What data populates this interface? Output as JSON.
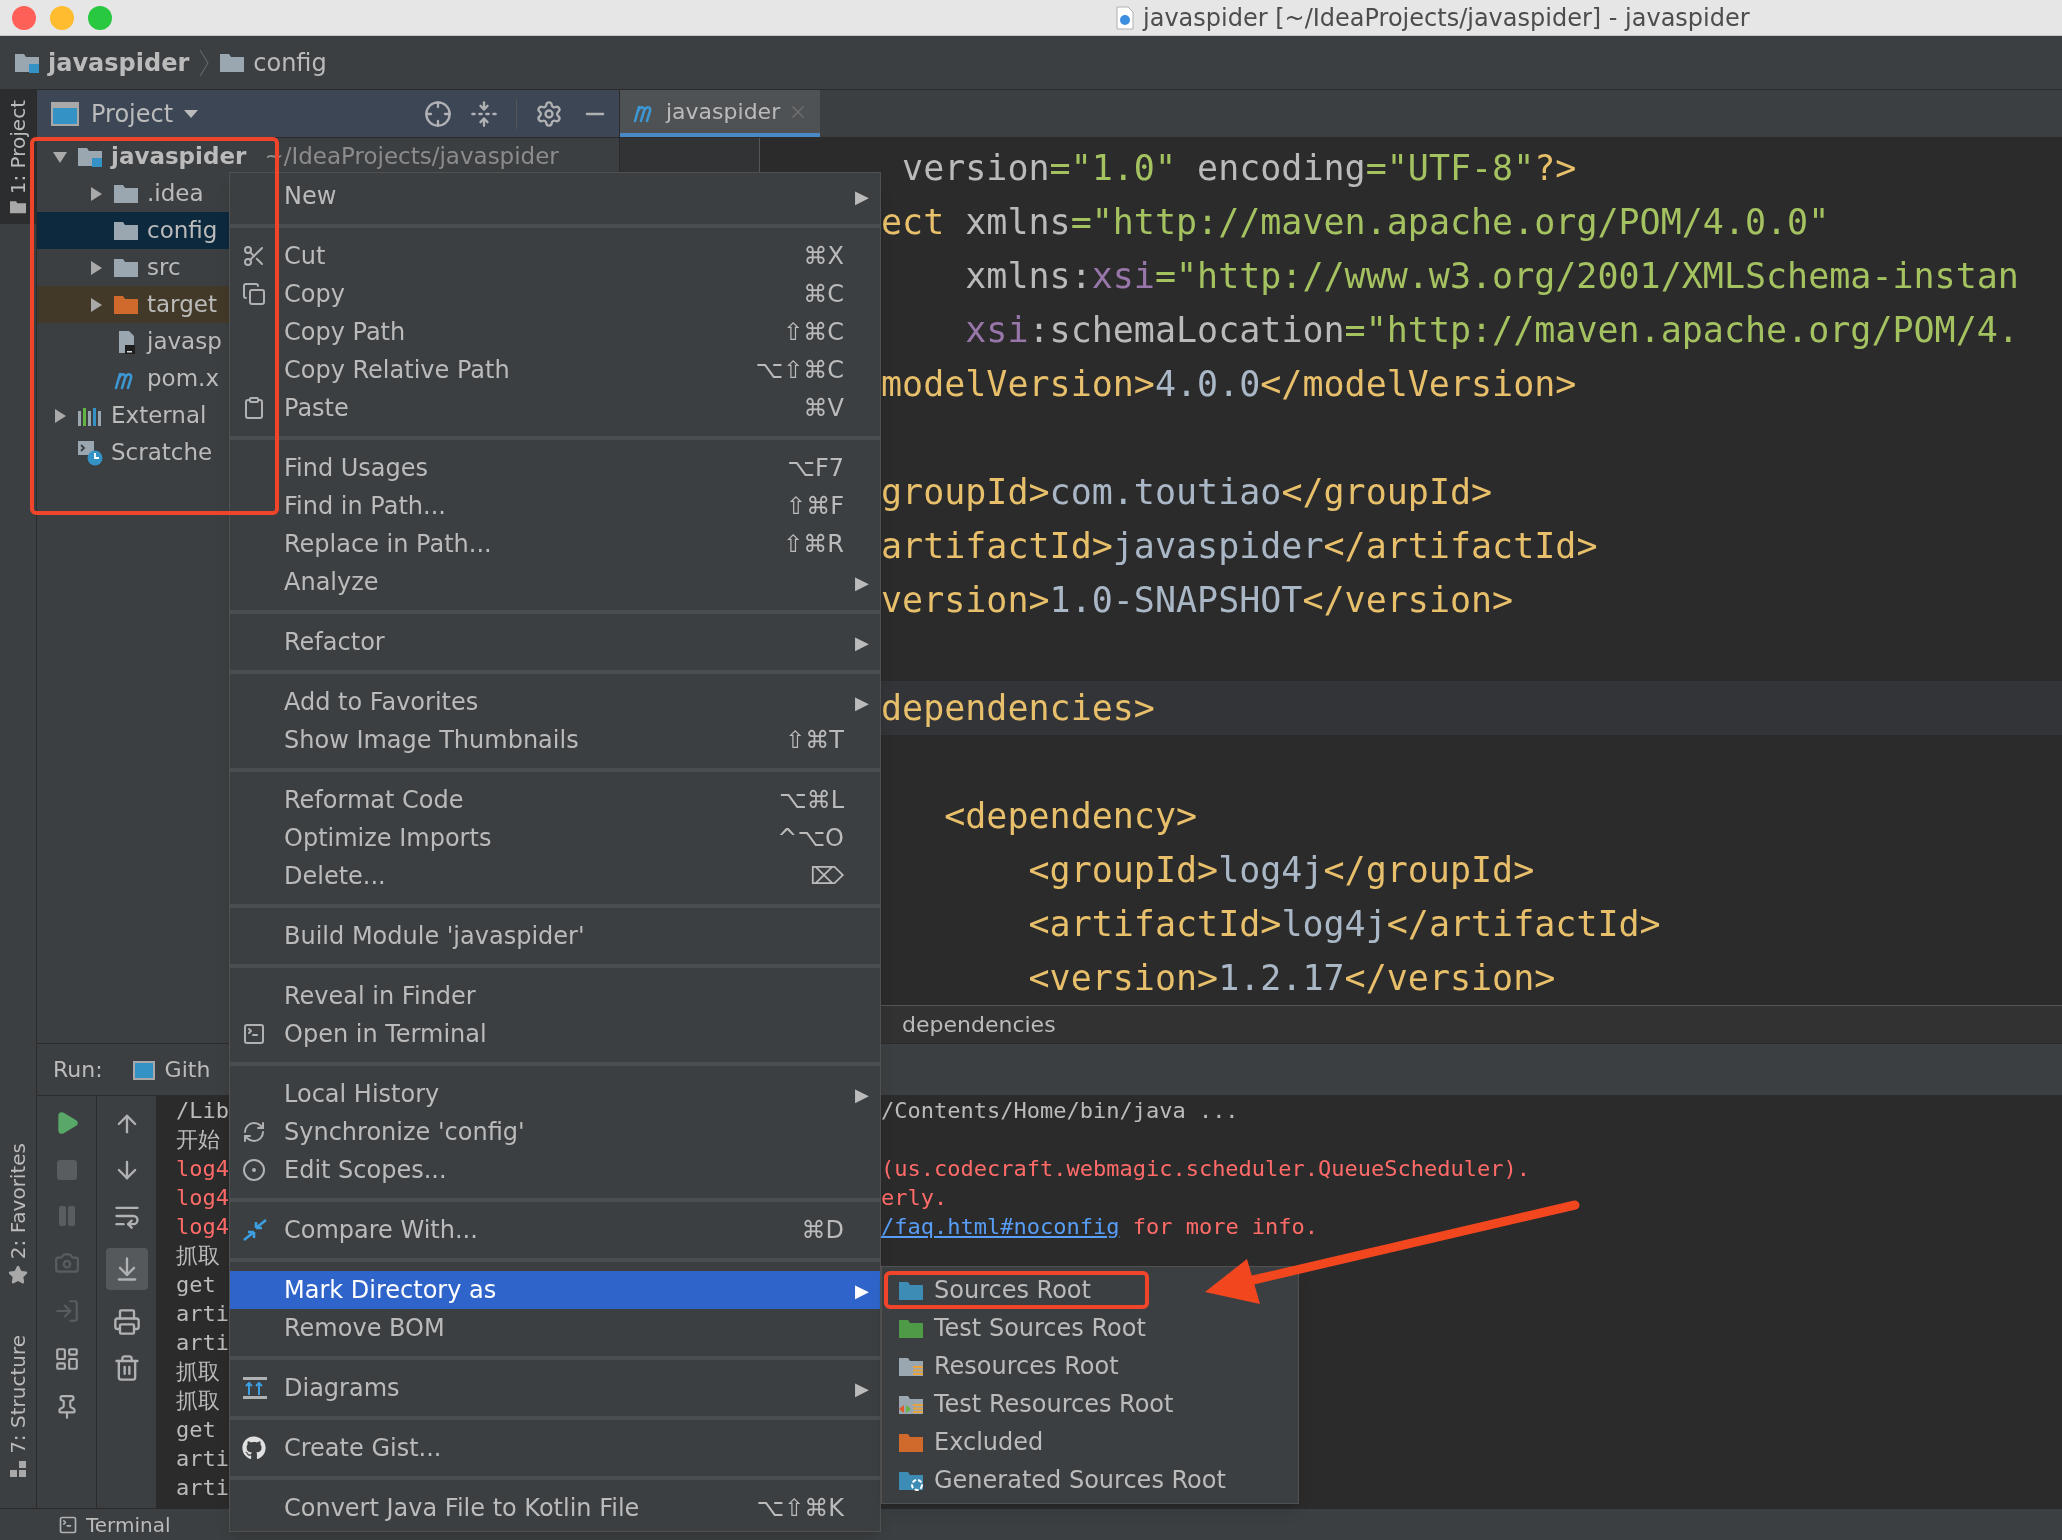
{
  "window": {
    "title": "javaspider [~/IdeaProjects/javaspider] - javaspider"
  },
  "breadcrumb": [
    {
      "label": "javaspider",
      "kind": "module"
    },
    {
      "label": "config",
      "kind": "folder"
    }
  ],
  "tool_window_tabs": [
    {
      "label": "1: Project",
      "selected": true,
      "kind": "project"
    },
    {
      "label": "2: Favorites",
      "selected": false,
      "kind": "favorites"
    },
    {
      "label": "7: Structure",
      "selected": false,
      "kind": "structure"
    }
  ],
  "project_panel": {
    "title": "Project",
    "tree": [
      {
        "label": "javaspider",
        "path": "~/IdeaProjects/javaspider",
        "kind": "module",
        "expanded": true,
        "selected": false,
        "children": [
          {
            "label": ".idea",
            "kind": "folder",
            "expanded": false,
            "selected": false
          },
          {
            "label": "config",
            "kind": "folder",
            "selected": true
          },
          {
            "label": "src",
            "kind": "folder",
            "expanded": false,
            "selected": false
          },
          {
            "label": "target",
            "kind": "excluded-folder",
            "expanded": false,
            "selected": false
          },
          {
            "label": "javasp",
            "kind": "iml-file",
            "selected": false
          },
          {
            "label": "pom.x",
            "kind": "maven-file",
            "selected": false
          }
        ]
      },
      {
        "label": "External",
        "kind": "libraries",
        "expanded": false,
        "selected": false
      },
      {
        "label": "Scratche",
        "kind": "scratches",
        "selected": false
      }
    ]
  },
  "editor": {
    "tabs": [
      {
        "label": "javaspider",
        "selected": true
      }
    ],
    "lines": [
      {
        "current": false,
        "tokens": [
          {
            "text": " version",
            "kind": "attr"
          },
          {
            "text": "=\"1.0\"",
            "kind": "string"
          },
          {
            "text": " encoding",
            "kind": "attr"
          },
          {
            "text": "=\"UTF-8\"",
            "kind": "string"
          },
          {
            "text": "?>",
            "kind": "tag"
          }
        ]
      },
      {
        "current": false,
        "tokens": [
          {
            "text": "ect",
            "kind": "tag"
          },
          {
            "text": " xmlns",
            "kind": "attr"
          },
          {
            "text": "=\"http://maven.apache.org/POM/4.0.0\"",
            "kind": "string"
          }
        ]
      },
      {
        "current": false,
        "tokens": [
          {
            "text": "    xmlns:",
            "kind": "attr"
          },
          {
            "text": "xsi",
            "kind": "ns"
          },
          {
            "text": "=\"http://www.w3.org/2001/XMLSchema-instan",
            "kind": "string"
          }
        ]
      },
      {
        "current": false,
        "tokens": [
          {
            "text": "    xsi",
            "kind": "ns"
          },
          {
            "text": ":schemaLocation",
            "kind": "attr"
          },
          {
            "text": "=\"http://maven.apache.org/POM/4.",
            "kind": "string"
          }
        ]
      },
      {
        "current": false,
        "tokens": [
          {
            "text": "modelVersion>",
            "kind": "tag"
          },
          {
            "text": "4.0.0",
            "kind": "text"
          },
          {
            "text": "</modelVersion>",
            "kind": "tag"
          }
        ]
      },
      {
        "current": false
      },
      {
        "current": false,
        "tokens": [
          {
            "text": "groupId>",
            "kind": "tag"
          },
          {
            "text": "com.toutiao",
            "kind": "text"
          },
          {
            "text": "</groupId>",
            "kind": "tag"
          }
        ]
      },
      {
        "current": false,
        "tokens": [
          {
            "text": "artifactId>",
            "kind": "tag"
          },
          {
            "text": "javaspider",
            "kind": "text"
          },
          {
            "text": "</artifactId>",
            "kind": "tag"
          }
        ]
      },
      {
        "current": false,
        "tokens": [
          {
            "text": "version>",
            "kind": "tag"
          },
          {
            "text": "1.0-SNAPSHOT",
            "kind": "text"
          },
          {
            "text": "</version>",
            "kind": "tag"
          }
        ]
      },
      {
        "current": false
      },
      {
        "current": true,
        "tokens": [
          {
            "text": "dependencies>",
            "kind": "tag"
          }
        ]
      },
      {
        "current": false
      },
      {
        "current": false,
        "tokens": [
          {
            "text": "   <dependency>",
            "kind": "tag"
          }
        ]
      },
      {
        "current": false,
        "tokens": [
          {
            "text": "       <groupId>",
            "kind": "tag"
          },
          {
            "text": "log4j",
            "kind": "text"
          },
          {
            "text": "</groupId>",
            "kind": "tag"
          }
        ]
      },
      {
        "current": false,
        "tokens": [
          {
            "text": "       <artifactId>",
            "kind": "tag"
          },
          {
            "text": "log4j",
            "kind": "text"
          },
          {
            "text": "</artifactId>",
            "kind": "tag"
          }
        ]
      },
      {
        "current": false,
        "tokens": [
          {
            "text": "       <version>",
            "kind": "tag"
          },
          {
            "text": "1.2.17",
            "kind": "text"
          },
          {
            "text": "</version>",
            "kind": "tag"
          }
        ]
      }
    ],
    "breadcrumb": "dependencies"
  },
  "run_panel": {
    "title": "Run:",
    "tabs": [
      {
        "label": "Gith"
      }
    ],
    "scroll_to_end": {
      "selected": true
    },
    "console": [
      {
        "left": "/Lib",
        "kind": "info",
        "segments": [
          {
            "text": "/Contents/Home/bin/java ...",
            "kind": "text"
          }
        ]
      },
      {
        "left": "开始",
        "kind": "info"
      },
      {
        "left": "log4",
        "kind": "error",
        "segments": [
          {
            "text": "(us.codecraft.webmagic.scheduler.QueueScheduler).",
            "kind": "text"
          }
        ]
      },
      {
        "left": "log4",
        "kind": "error",
        "segments": [
          {
            "text": "erly.",
            "kind": "text"
          }
        ]
      },
      {
        "left": "log4",
        "kind": "error",
        "segments": [
          {
            "text": "/faq.html#noconfig",
            "kind": "link"
          },
          {
            "text": " for more info.",
            "kind": "text"
          }
        ]
      },
      {
        "left": "抓取",
        "kind": "info"
      },
      {
        "left": "get",
        "kind": "info"
      },
      {
        "left": "arti",
        "kind": "info"
      },
      {
        "left": "arti",
        "kind": "info"
      },
      {
        "left": "抓取",
        "kind": "info"
      },
      {
        "left": "抓取",
        "kind": "info"
      },
      {
        "left": "get",
        "kind": "info"
      },
      {
        "left": "arti",
        "kind": "info"
      },
      {
        "left": "arti",
        "kind": "info"
      }
    ]
  },
  "bottom_bar": {
    "tabs": [
      {
        "label": "Terminal"
      }
    ]
  },
  "context_menu": {
    "groups": [
      [
        {
          "label": "New",
          "arrow": "▶",
          "selected": false
        }
      ],
      [
        {
          "label": "Cut",
          "shortcut": "⌘X",
          "kind": "cut",
          "selected": false
        },
        {
          "label": "Copy",
          "shortcut": "⌘C",
          "kind": "copy",
          "selected": false
        },
        {
          "label": "Copy Path",
          "shortcut": "⇧⌘C",
          "selected": false
        },
        {
          "label": "Copy Relative Path",
          "shortcut": "⌥⇧⌘C",
          "selected": false
        },
        {
          "label": "Paste",
          "shortcut": "⌘V",
          "kind": "paste",
          "selected": false
        }
      ],
      [
        {
          "label": "Find Usages",
          "shortcut": "⌥F7",
          "selected": false
        },
        {
          "label": "Find in Path...",
          "shortcut": "⇧⌘F",
          "selected": false
        },
        {
          "label": "Replace in Path...",
          "shortcut": "⇧⌘R",
          "selected": false
        },
        {
          "label": "Analyze",
          "arrow": "▶",
          "selected": false
        }
      ],
      [
        {
          "label": "Refactor",
          "arrow": "▶",
          "selected": false
        }
      ],
      [
        {
          "label": "Add to Favorites",
          "arrow": "▶",
          "selected": false
        },
        {
          "label": "Show Image Thumbnails",
          "shortcut": "⇧⌘T",
          "selected": false
        }
      ],
      [
        {
          "label": "Reformat Code",
          "shortcut": "⌥⌘L",
          "selected": false
        },
        {
          "label": "Optimize Imports",
          "shortcut": "^⌥O",
          "selected": false
        },
        {
          "label": "Delete...",
          "shortcut": "⌦",
          "selected": false
        }
      ],
      [
        {
          "label": "Build Module 'javaspider'",
          "selected": false
        }
      ],
      [
        {
          "label": "Reveal in Finder",
          "selected": false
        },
        {
          "label": "Open in Terminal",
          "kind": "terminal",
          "selected": false
        }
      ],
      [
        {
          "label": "Local History",
          "arrow": "▶",
          "selected": false
        },
        {
          "label": "Synchronize 'config'",
          "kind": "sync",
          "selected": false
        },
        {
          "label": "Edit Scopes...",
          "kind": "scope",
          "selected": false
        }
      ],
      [
        {
          "label": "Compare With...",
          "shortcut": "⌘D",
          "kind": "compare",
          "selected": false
        }
      ],
      [
        {
          "label": "Mark Directory as",
          "arrow": "▶",
          "selected": true
        },
        {
          "label": "Remove BOM",
          "selected": false
        }
      ],
      [
        {
          "label": "Diagrams",
          "kind": "diagram",
          "arrow": "▶",
          "selected": false
        }
      ],
      [
        {
          "label": "Create Gist...",
          "kind": "github",
          "selected": false
        }
      ],
      [
        {
          "label": "Convert Java File to Kotlin File",
          "shortcut": "⌥⇧⌘K",
          "selected": false
        }
      ]
    ]
  },
  "submenu": {
    "items": [
      {
        "label": "Sources Root",
        "kind": "sources",
        "annotated": true
      },
      {
        "label": "Test Sources Root",
        "kind": "test-sources",
        "annotated": false
      },
      {
        "label": "Resources Root",
        "kind": "resources",
        "annotated": false
      },
      {
        "label": "Test Resources Root",
        "kind": "test-resources",
        "annotated": false
      },
      {
        "label": "Excluded",
        "kind": "excluded",
        "annotated": false
      },
      {
        "label": "Generated Sources Root",
        "kind": "generated",
        "annotated": false
      }
    ]
  }
}
